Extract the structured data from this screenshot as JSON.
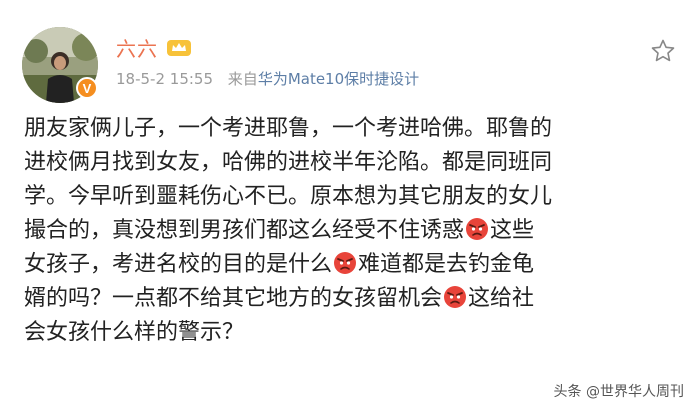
{
  "post": {
    "username": "六六",
    "date": "18-5-2",
    "time": "15:55",
    "source_prefix": "来自",
    "source": "华为Mate10保时捷设计",
    "content_lines": [
      [
        "朋友家俩儿子，一个考进耶鲁，一个考进哈佛。耶鲁的"
      ],
      [
        "进校俩月找到女友，哈佛的进校半年沦陷。都是同班同"
      ],
      [
        "学。今早听到噩耗伤心不已。原本想为其它朋友的女儿"
      ],
      [
        "撮合的，真没想到男孩们都这么经受不住诱惑",
        "这些"
      ],
      [
        "女孩子，考进名校的目的是什么",
        "难道都是去钓金龟"
      ],
      [
        "婿的吗？一点都不给其它地方的女孩留机会",
        "这给社"
      ],
      [
        "会女孩什么样的警示？"
      ]
    ],
    "emoji_name": "angry-face-icon"
  },
  "watermark": {
    "text": "头条 @世界华人周刊"
  },
  "colors": {
    "username": "#eb7350",
    "meta": "#9a9a9a",
    "source": "#5d7ea6",
    "verified": "#f58e1f",
    "emoji": "#e8443a"
  }
}
